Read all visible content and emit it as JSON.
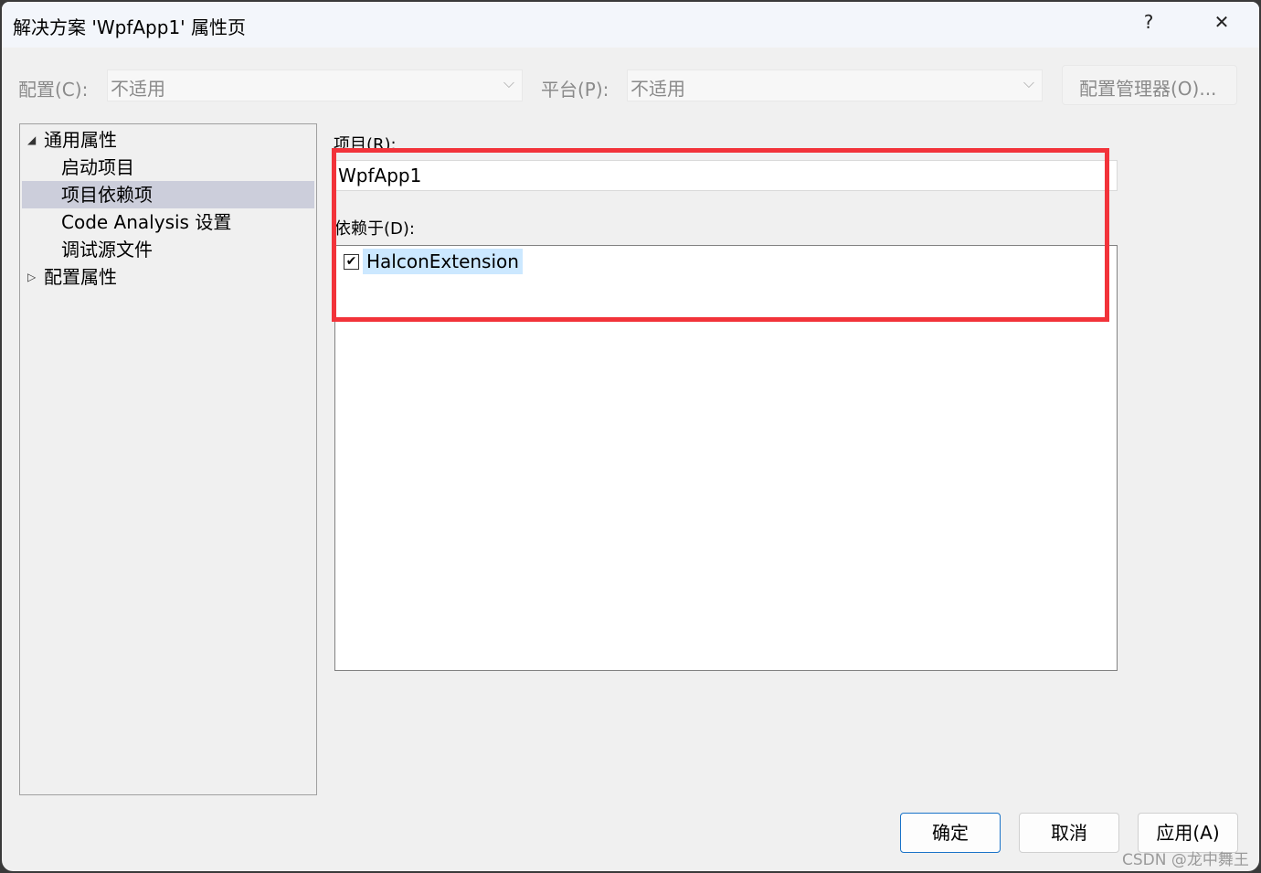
{
  "window": {
    "title": "解决方案 'WpfApp1' 属性页",
    "help": "?",
    "close": "✕"
  },
  "config": {
    "label": "配置(C):",
    "value": "不适用",
    "platform_label": "平台(P):",
    "platform_value": "不适用",
    "manager_button": "配置管理器(O)..."
  },
  "tree": {
    "items": [
      {
        "label": "通用属性",
        "expanded": true,
        "arrow": "◢"
      },
      {
        "label": "启动项目"
      },
      {
        "label": "项目依赖项",
        "selected": true
      },
      {
        "label": "Code Analysis 设置"
      },
      {
        "label": "调试源文件"
      },
      {
        "label": "配置属性",
        "expanded": false,
        "arrow": "▷"
      }
    ]
  },
  "main": {
    "project_label": "项目(R):",
    "project_value": "WpfApp1",
    "depends_label": "依赖于(D):",
    "dependencies": [
      {
        "label": "HalconExtension",
        "checked": true,
        "mark": "✔"
      }
    ]
  },
  "buttons": {
    "ok": "确定",
    "cancel": "取消",
    "apply": "应用(A)"
  },
  "watermark": "CSDN @龙中舞王",
  "colors": {
    "highlight_box": "#f2333a",
    "selection": "#cccedb"
  }
}
